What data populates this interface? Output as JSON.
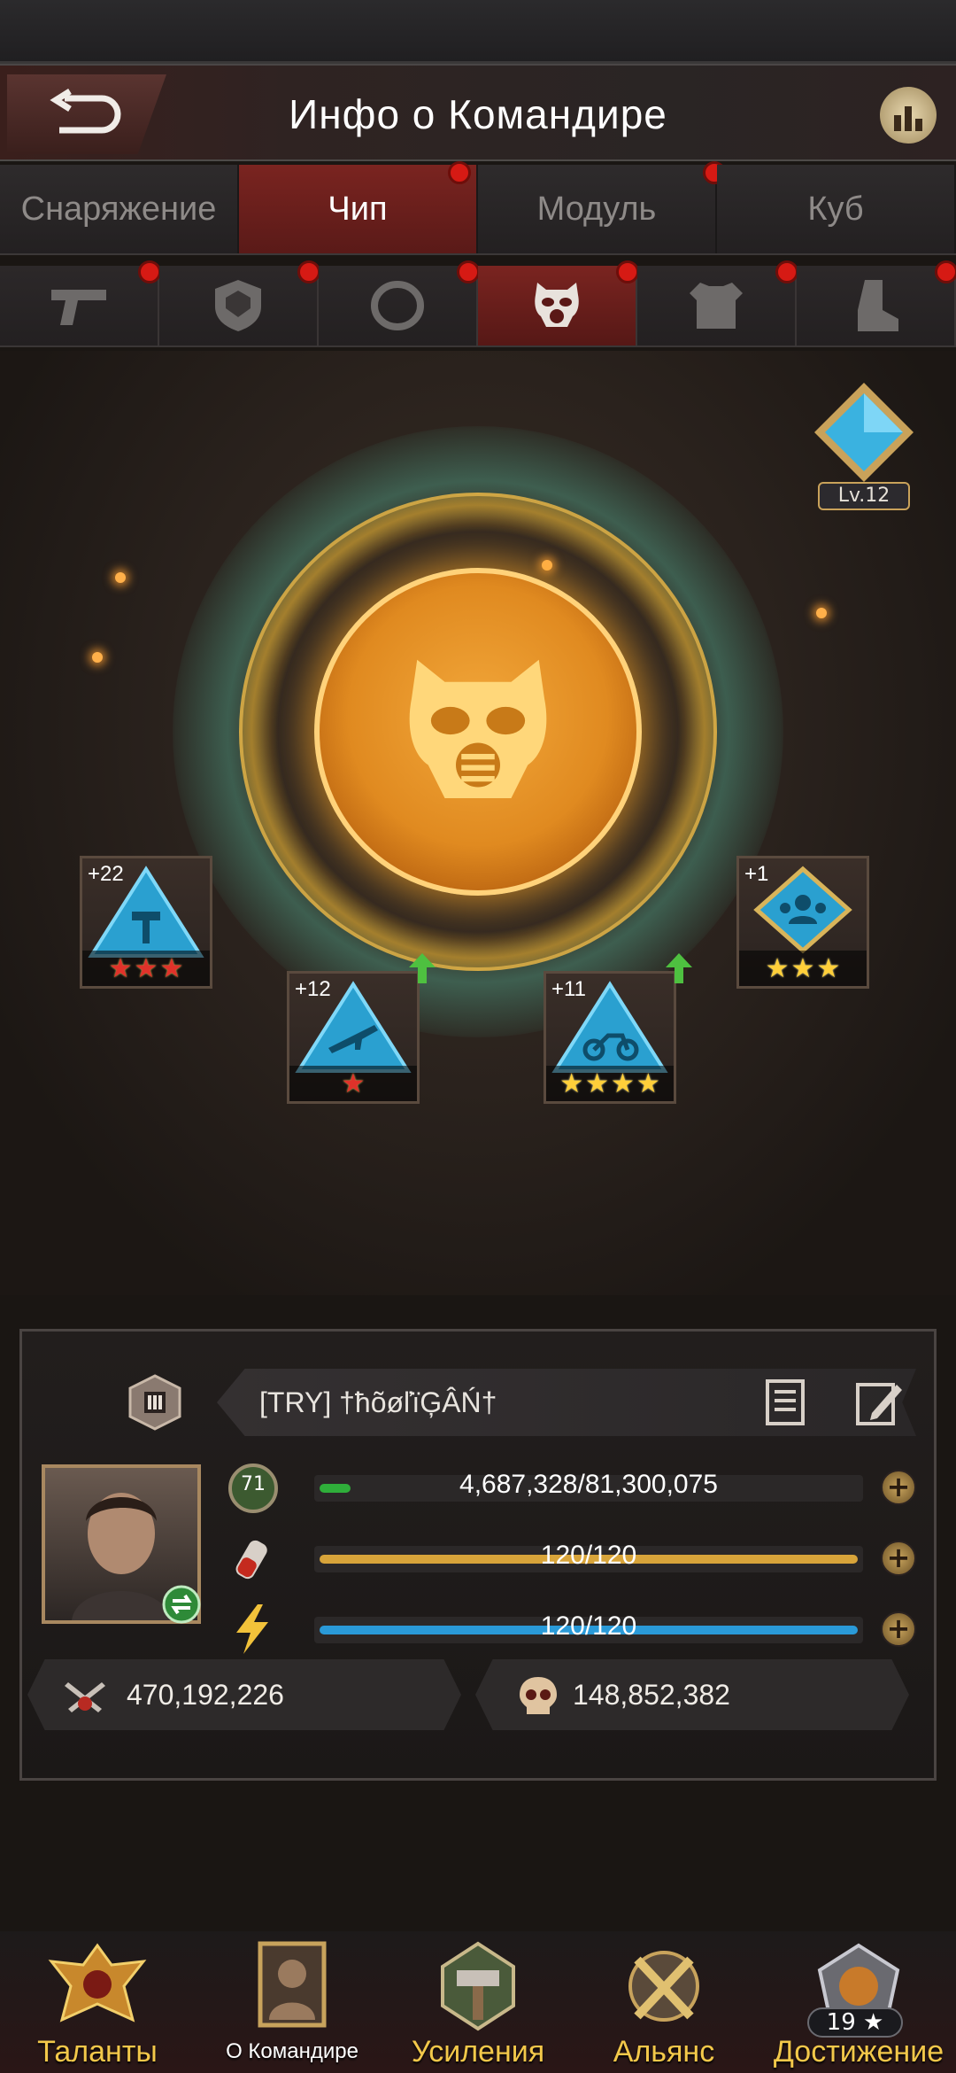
{
  "header": {
    "title": "Инфо о Командире",
    "back_icon": "back-arrow-icon",
    "stats_icon": "bar-chart-icon"
  },
  "tabs": [
    {
      "label": "Снаряжение",
      "active": false,
      "badge": false
    },
    {
      "label": "Чип",
      "active": true,
      "badge": true
    },
    {
      "label": "Модуль",
      "active": false,
      "badge": true
    },
    {
      "label": "Куб",
      "active": false,
      "badge": false
    }
  ],
  "slots": [
    {
      "icon": "pistol-icon",
      "active": false,
      "badge": true
    },
    {
      "icon": "shield-icon",
      "active": false,
      "badge": true
    },
    {
      "icon": "ring-icon",
      "active": false,
      "badge": true
    },
    {
      "icon": "gas-mask-icon",
      "active": true,
      "badge": true
    },
    {
      "icon": "armor-icon",
      "active": false,
      "badge": true
    },
    {
      "icon": "boot-icon",
      "active": false,
      "badge": true
    }
  ],
  "center": {
    "icon": "gas-mask-icon",
    "level": "Lv.12"
  },
  "chips": [
    {
      "plus": "+22",
      "stars": 3,
      "star_color": "red",
      "upgradable": false
    },
    {
      "plus": "+12",
      "stars": 1,
      "star_color": "red",
      "upgradable": true
    },
    {
      "plus": "+11",
      "stars": 4,
      "star_color": "gold",
      "upgradable": true
    },
    {
      "plus": "+1",
      "stars": 3,
      "star_color": "gold",
      "upgradable": false
    }
  ],
  "profile": {
    "name": "[TRY]   †ħõøľïĢÂŃ†",
    "rank_badge": "III",
    "level": "71",
    "exp_text": "4,687,328/81,300,075",
    "exp_fraction": 0.058,
    "stamina_text": "120/120",
    "stamina_fraction": 1.0,
    "energy_text": "120/120",
    "energy_fraction": 1.0,
    "power": "470,192,226",
    "kills": "148,852,382"
  },
  "colors": {
    "accent_red": "#7a2420",
    "badge_red": "#d61a14",
    "exp_green": "#2fae3a",
    "stamina_gold": "#d8a43a",
    "energy_blue": "#2a9ad8",
    "nav_gold": "#f3c84a"
  },
  "nav": {
    "talents": "Таланты",
    "commander": "О Командире",
    "boosts": "Усиления",
    "alliance": "Альянс",
    "achievement": "Достижение",
    "achievement_count": "19 ★"
  }
}
